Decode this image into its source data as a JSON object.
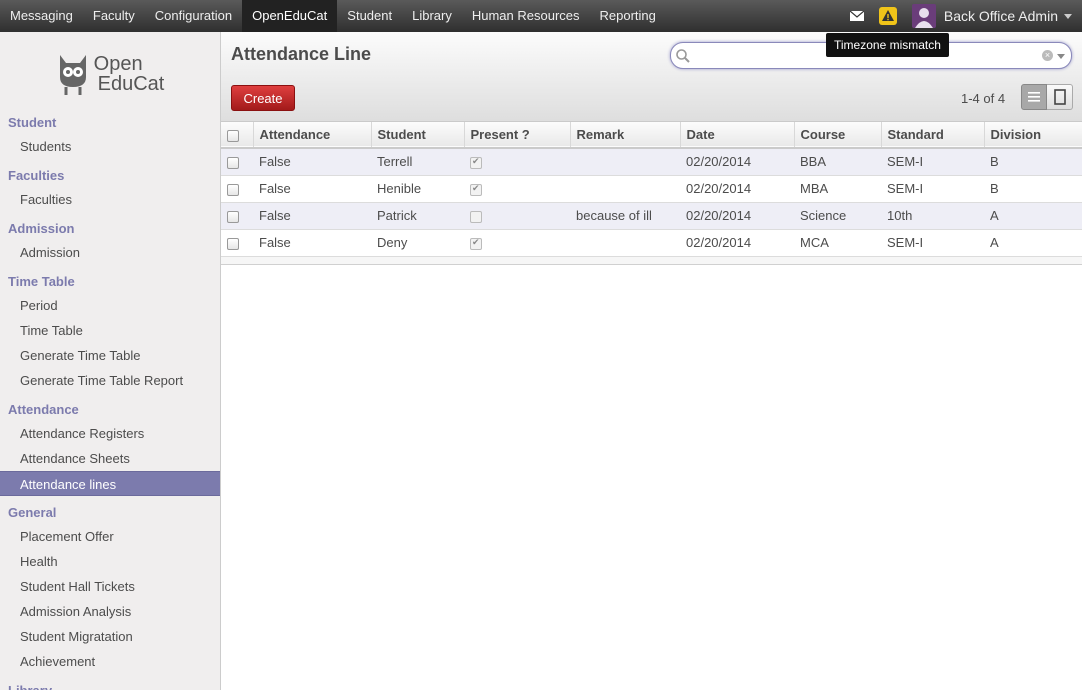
{
  "topbar": {
    "menu": [
      "Messaging",
      "Faculty",
      "Configuration",
      "OpenEduCat",
      "Student",
      "Library",
      "Human Resources",
      "Reporting"
    ],
    "active_menu": "OpenEduCat",
    "user_name": "Back Office Admin",
    "tooltip": "Timezone mismatch"
  },
  "logo": {
    "line1": "Open",
    "line2": "EduCat"
  },
  "sidebar": {
    "sections": [
      {
        "title": "Student",
        "items": [
          "Students"
        ]
      },
      {
        "title": "Faculties",
        "items": [
          "Faculties"
        ]
      },
      {
        "title": "Admission",
        "items": [
          "Admission"
        ]
      },
      {
        "title": "Time Table",
        "items": [
          "Period",
          "Time Table",
          "Generate Time Table",
          "Generate Time Table Report"
        ]
      },
      {
        "title": "Attendance",
        "items": [
          "Attendance Registers",
          "Attendance Sheets",
          "Attendance lines"
        ]
      },
      {
        "title": "General",
        "items": [
          "Placement Offer",
          "Health",
          "Student Hall Tickets",
          "Admission Analysis",
          "Student Migratation",
          "Achievement"
        ]
      },
      {
        "title": "Library",
        "items": []
      }
    ],
    "active_item": "Attendance lines"
  },
  "main": {
    "title": "Attendance Line",
    "search_value": "",
    "create_label": "Create",
    "pager": "1-4 of 4"
  },
  "table": {
    "columns": [
      "Attendance",
      "Student",
      "Present ?",
      "Remark",
      "Date",
      "Course",
      "Standard",
      "Division"
    ],
    "rows": [
      {
        "attendance": "False",
        "student": "Terrell",
        "present": true,
        "remark": "",
        "date": "02/20/2014",
        "course": "BBA",
        "standard": "SEM-I",
        "division": "B"
      },
      {
        "attendance": "False",
        "student": "Henible",
        "present": true,
        "remark": "",
        "date": "02/20/2014",
        "course": "MBA",
        "standard": "SEM-I",
        "division": "B"
      },
      {
        "attendance": "False",
        "student": "Patrick",
        "present": false,
        "remark": "because of ill",
        "date": "02/20/2014",
        "course": "Science",
        "standard": "10th",
        "division": "A"
      },
      {
        "attendance": "False",
        "student": "Deny",
        "present": true,
        "remark": "",
        "date": "02/20/2014",
        "course": "MCA",
        "standard": "SEM-I",
        "division": "A"
      }
    ]
  },
  "colors": {
    "accent": "#7c7bad",
    "create": "#c42727",
    "topbar": "#3a3a3a"
  }
}
